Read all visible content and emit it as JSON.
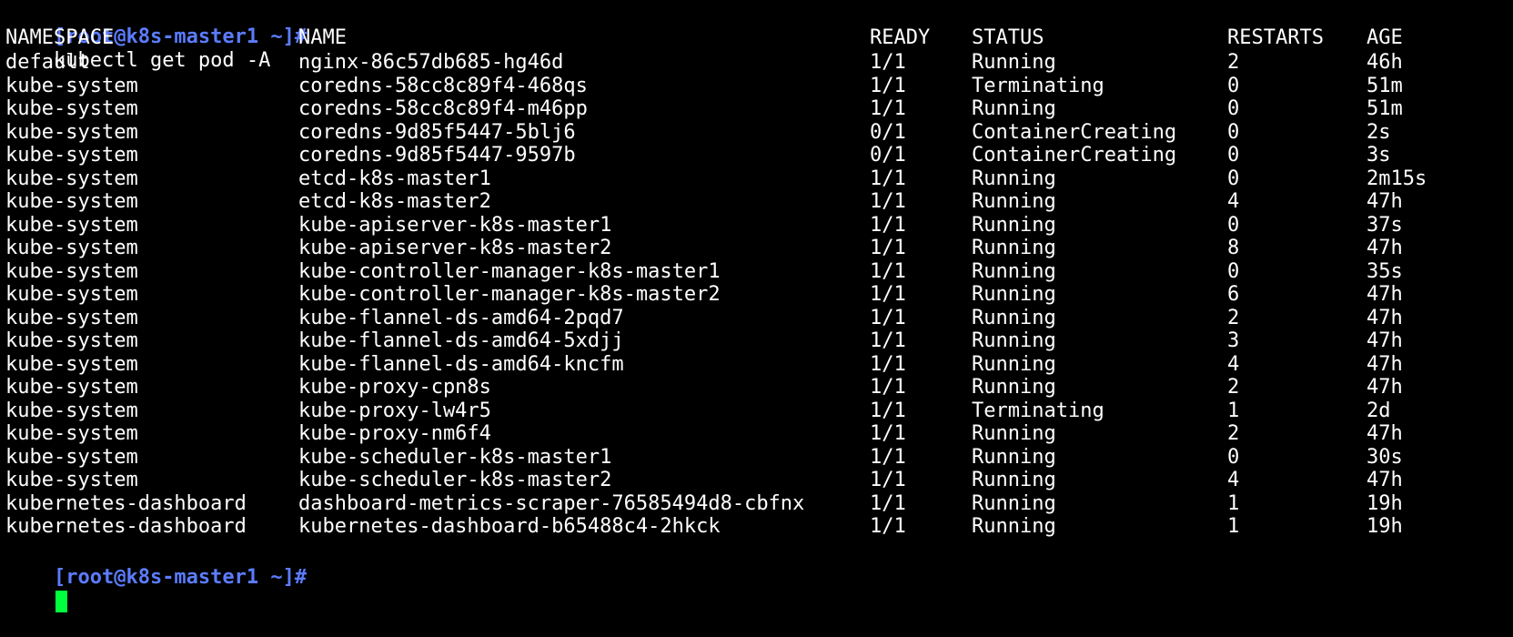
{
  "prompt": "[root@k8s-master1 ~]#",
  "command": "kubectl get pod -A",
  "headers": {
    "namespace": "NAMESPACE",
    "name": "NAME",
    "ready": "READY",
    "status": "STATUS",
    "restarts": "RESTARTS",
    "age": "AGE"
  },
  "rows": [
    {
      "namespace": "default",
      "name": "nginx-86c57db685-hg46d",
      "ready": "1/1",
      "status": "Running",
      "restarts": "2",
      "age": "46h"
    },
    {
      "namespace": "kube-system",
      "name": "coredns-58cc8c89f4-468qs",
      "ready": "1/1",
      "status": "Terminating",
      "restarts": "0",
      "age": "51m"
    },
    {
      "namespace": "kube-system",
      "name": "coredns-58cc8c89f4-m46pp",
      "ready": "1/1",
      "status": "Running",
      "restarts": "0",
      "age": "51m"
    },
    {
      "namespace": "kube-system",
      "name": "coredns-9d85f5447-5blj6",
      "ready": "0/1",
      "status": "ContainerCreating",
      "restarts": "0",
      "age": "2s"
    },
    {
      "namespace": "kube-system",
      "name": "coredns-9d85f5447-9597b",
      "ready": "0/1",
      "status": "ContainerCreating",
      "restarts": "0",
      "age": "3s"
    },
    {
      "namespace": "kube-system",
      "name": "etcd-k8s-master1",
      "ready": "1/1",
      "status": "Running",
      "restarts": "0",
      "age": "2m15s"
    },
    {
      "namespace": "kube-system",
      "name": "etcd-k8s-master2",
      "ready": "1/1",
      "status": "Running",
      "restarts": "4",
      "age": "47h"
    },
    {
      "namespace": "kube-system",
      "name": "kube-apiserver-k8s-master1",
      "ready": "1/1",
      "status": "Running",
      "restarts": "0",
      "age": "37s"
    },
    {
      "namespace": "kube-system",
      "name": "kube-apiserver-k8s-master2",
      "ready": "1/1",
      "status": "Running",
      "restarts": "8",
      "age": "47h"
    },
    {
      "namespace": "kube-system",
      "name": "kube-controller-manager-k8s-master1",
      "ready": "1/1",
      "status": "Running",
      "restarts": "0",
      "age": "35s"
    },
    {
      "namespace": "kube-system",
      "name": "kube-controller-manager-k8s-master2",
      "ready": "1/1",
      "status": "Running",
      "restarts": "6",
      "age": "47h"
    },
    {
      "namespace": "kube-system",
      "name": "kube-flannel-ds-amd64-2pqd7",
      "ready": "1/1",
      "status": "Running",
      "restarts": "2",
      "age": "47h"
    },
    {
      "namespace": "kube-system",
      "name": "kube-flannel-ds-amd64-5xdjj",
      "ready": "1/1",
      "status": "Running",
      "restarts": "3",
      "age": "47h"
    },
    {
      "namespace": "kube-system",
      "name": "kube-flannel-ds-amd64-kncfm",
      "ready": "1/1",
      "status": "Running",
      "restarts": "4",
      "age": "47h"
    },
    {
      "namespace": "kube-system",
      "name": "kube-proxy-cpn8s",
      "ready": "1/1",
      "status": "Running",
      "restarts": "2",
      "age": "47h"
    },
    {
      "namespace": "kube-system",
      "name": "kube-proxy-lw4r5",
      "ready": "1/1",
      "status": "Terminating",
      "restarts": "1",
      "age": "2d"
    },
    {
      "namespace": "kube-system",
      "name": "kube-proxy-nm6f4",
      "ready": "1/1",
      "status": "Running",
      "restarts": "2",
      "age": "47h"
    },
    {
      "namespace": "kube-system",
      "name": "kube-scheduler-k8s-master1",
      "ready": "1/1",
      "status": "Running",
      "restarts": "0",
      "age": "30s"
    },
    {
      "namespace": "kube-system",
      "name": "kube-scheduler-k8s-master2",
      "ready": "1/1",
      "status": "Running",
      "restarts": "4",
      "age": "47h"
    },
    {
      "namespace": "kubernetes-dashboard",
      "name": "dashboard-metrics-scraper-76585494d8-cbfnx",
      "ready": "1/1",
      "status": "Running",
      "restarts": "1",
      "age": "19h"
    },
    {
      "namespace": "kubernetes-dashboard",
      "name": "kubernetes-dashboard-b65488c4-2hkck",
      "ready": "1/1",
      "status": "Running",
      "restarts": "1",
      "age": "19h"
    }
  ],
  "colors": {
    "background": "#000000",
    "text": "#ffffff",
    "prompt": "#5c7cff",
    "cursor": "#00ff3c"
  }
}
